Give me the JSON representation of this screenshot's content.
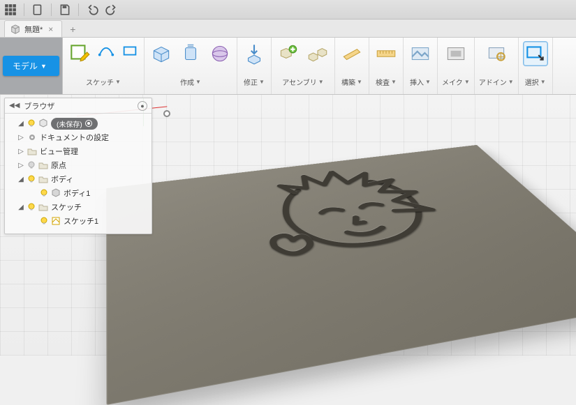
{
  "qat": {
    "tooltips": [
      "data-panel",
      "grid-view",
      "file",
      "save",
      "undo",
      "redo"
    ]
  },
  "tab": {
    "title": "無題*",
    "close": "×",
    "new": "+"
  },
  "workspace": {
    "label": "モデル",
    "arrow": "▼"
  },
  "ribbon": {
    "groups": [
      {
        "id": "sketch",
        "label": "スケッチ",
        "has_drop": true
      },
      {
        "id": "create",
        "label": "作成",
        "has_drop": true
      },
      {
        "id": "modify",
        "label": "修正",
        "has_drop": true
      },
      {
        "id": "assembly",
        "label": "アセンブリ",
        "has_drop": true
      },
      {
        "id": "construct",
        "label": "構築",
        "has_drop": true
      },
      {
        "id": "inspect",
        "label": "検査",
        "has_drop": true
      },
      {
        "id": "insert",
        "label": "挿入",
        "has_drop": true
      },
      {
        "id": "make",
        "label": "メイク",
        "has_drop": true
      },
      {
        "id": "addins",
        "label": "アドイン",
        "has_drop": true
      },
      {
        "id": "select",
        "label": "選択",
        "has_drop": true
      }
    ]
  },
  "browser": {
    "header": "ブラウザ",
    "root": "(未保存)",
    "nodes": {
      "doc_settings": "ドキュメントの設定",
      "views": "ビュー管理",
      "origin": "原点",
      "bodies": "ボディ",
      "body1": "ボディ1",
      "sketches": "スケッチ",
      "sketch1": "スケッチ1"
    }
  },
  "colors": {
    "accent": "#1792e5",
    "plate": "#7e7a6f"
  }
}
